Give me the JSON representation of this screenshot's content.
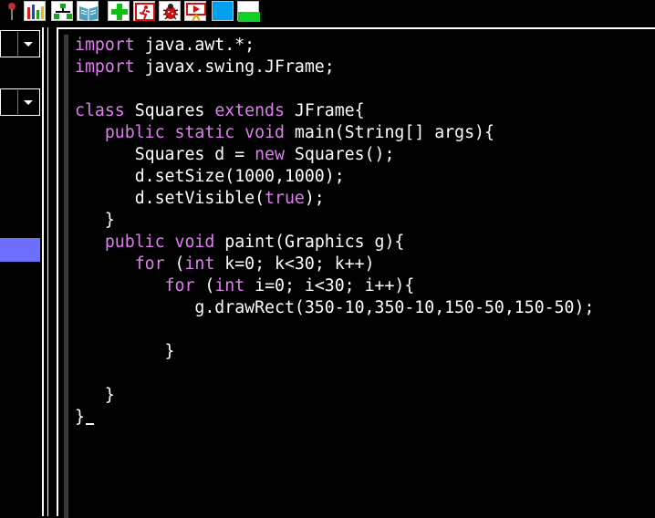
{
  "toolbar": {
    "buttons": [
      {
        "name": "pin-icon"
      },
      {
        "name": "bar-chart-icon"
      },
      {
        "name": "tree-icon"
      },
      {
        "name": "book-icon"
      },
      {
        "name": "add-icon"
      },
      {
        "name": "run-figure-icon"
      },
      {
        "name": "debug-bug-icon"
      },
      {
        "name": "play-figure-icon"
      },
      {
        "name": "blue-square-icon"
      },
      {
        "name": "green-white-icon"
      }
    ]
  },
  "editor": {
    "lines": [
      [
        {
          "t": "import",
          "k": true
        },
        {
          "t": " java.awt.*;"
        }
      ],
      [
        {
          "t": "import",
          "k": true
        },
        {
          "t": " javax.swing.JFrame;"
        }
      ],
      [],
      [
        {
          "t": "class",
          "k": true
        },
        {
          "t": " Squares "
        },
        {
          "t": "extends",
          "k": true
        },
        {
          "t": " JFrame{"
        }
      ],
      [
        {
          "t": "   "
        },
        {
          "t": "public",
          "k": true
        },
        {
          "t": " "
        },
        {
          "t": "static",
          "k": true
        },
        {
          "t": " "
        },
        {
          "t": "void",
          "k": true
        },
        {
          "t": " main(String[] args){"
        }
      ],
      [
        {
          "t": "      Squares d = "
        },
        {
          "t": "new",
          "k": true
        },
        {
          "t": " Squares();"
        }
      ],
      [
        {
          "t": "      d.setSize(1000,1000);"
        }
      ],
      [
        {
          "t": "      d.setVisible("
        },
        {
          "t": "true",
          "k": true
        },
        {
          "t": ");"
        }
      ],
      [
        {
          "t": "   }"
        }
      ],
      [
        {
          "t": "   "
        },
        {
          "t": "public",
          "k": true
        },
        {
          "t": " "
        },
        {
          "t": "void",
          "k": true
        },
        {
          "t": " paint(Graphics g){"
        }
      ],
      [
        {
          "t": "      "
        },
        {
          "t": "for",
          "k": true
        },
        {
          "t": " ("
        },
        {
          "t": "int",
          "k": true
        },
        {
          "t": " k=0; k<30; k++)"
        }
      ],
      [
        {
          "t": "         "
        },
        {
          "t": "for",
          "k": true
        },
        {
          "t": " ("
        },
        {
          "t": "int",
          "k": true
        },
        {
          "t": " i=0; i<30; i++){"
        }
      ],
      [
        {
          "t": "            g.drawRect(350-10,350-10,150-50,150-50);"
        }
      ],
      [],
      [
        {
          "t": "         }"
        }
      ],
      [],
      [
        {
          "t": "   }"
        }
      ],
      [
        {
          "t": "}"
        }
      ]
    ]
  },
  "colors": {
    "keyword": "#e07ef0",
    "text": "#ffffff",
    "background": "#000000",
    "selection": "#6f6fff"
  }
}
